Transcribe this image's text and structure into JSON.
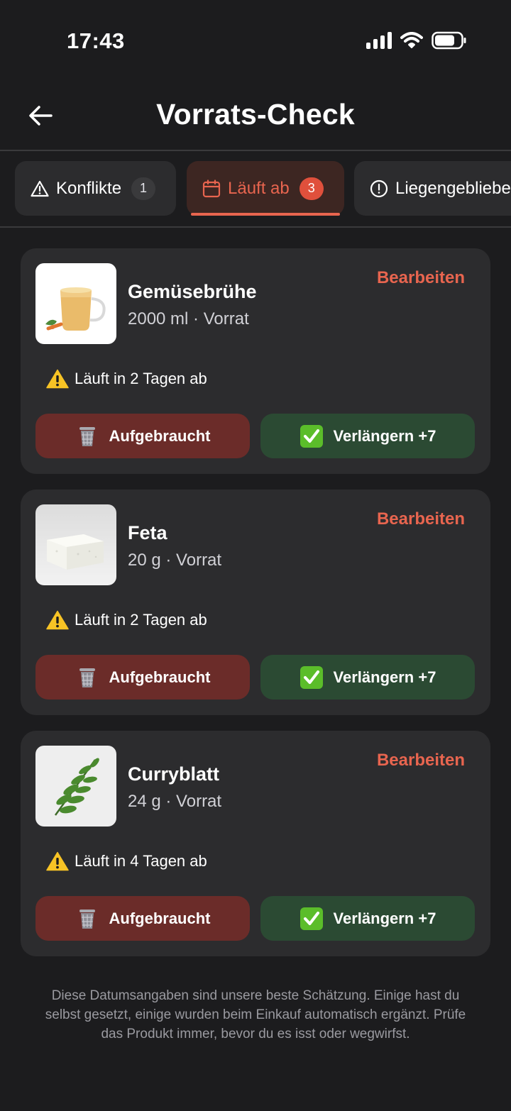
{
  "status_bar": {
    "time": "17:43"
  },
  "header": {
    "title": "Vorrats-Check"
  },
  "tabs": [
    {
      "label": "Konflikte",
      "count": "1",
      "icon": "warning-triangle-icon"
    },
    {
      "label": "Läuft ab",
      "count": "3",
      "icon": "calendar-icon",
      "active": true
    },
    {
      "label": "Liegengeblieben",
      "icon": "exclamation-circle-icon"
    }
  ],
  "items": [
    {
      "name": "Gemüsebrühe",
      "meta": "2000 ml · Vorrat",
      "edit": "Bearbeiten",
      "warning": "Läuft in 2 Tagen ab",
      "used_label": "Aufgebraucht",
      "extend_label": "Verlängern +7"
    },
    {
      "name": "Feta",
      "meta": "20 g · Vorrat",
      "edit": "Bearbeiten",
      "warning": "Läuft in 2 Tagen ab",
      "used_label": "Aufgebraucht",
      "extend_label": "Verlängern +7"
    },
    {
      "name": "Curryblatt",
      "meta": "24 g · Vorrat",
      "edit": "Bearbeiten",
      "warning": "Läuft in 4 Tagen ab",
      "used_label": "Aufgebraucht",
      "extend_label": "Verlängern +7"
    }
  ],
  "footnote": "Diese Datumsangaben sind unsere beste Schätzung. Einige hast du selbst gesetzt, einige wurden beim Einkauf automatisch ergänzt. Prüfe das Produkt immer, bevor du es isst oder wegwirfst.",
  "colors": {
    "background": "#1c1c1e",
    "card": "#2c2c2e",
    "accent": "#e8654f",
    "used_button": "#6b2c29",
    "extend_button": "#2b4a33"
  }
}
